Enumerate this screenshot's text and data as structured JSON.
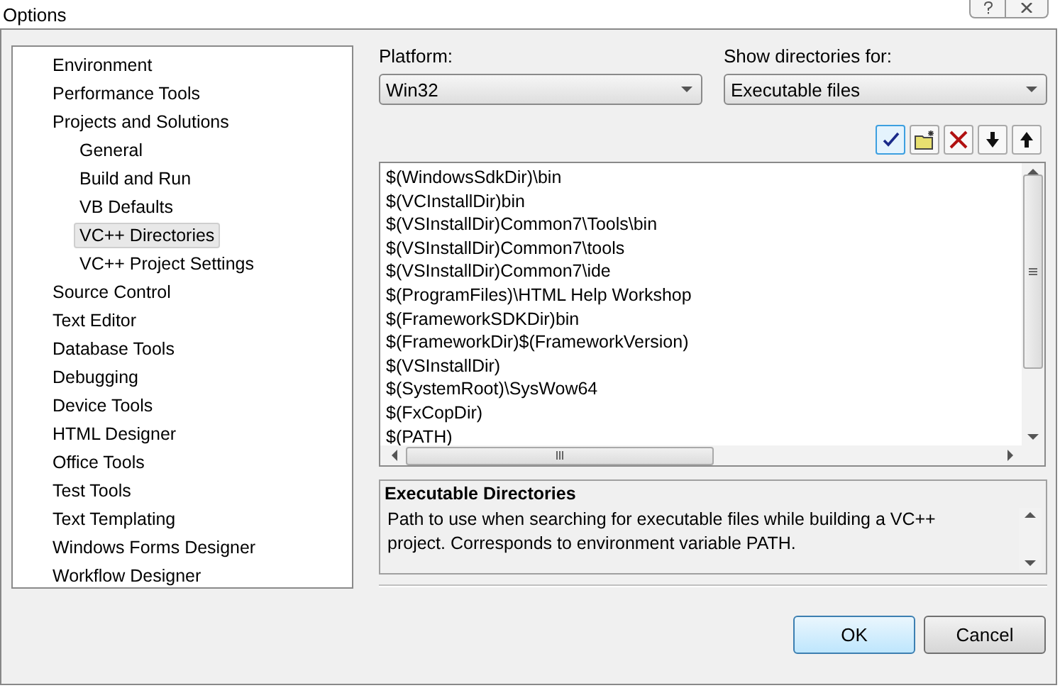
{
  "window": {
    "title": "Options"
  },
  "tree": [
    {
      "label": "Environment",
      "selected": false
    },
    {
      "label": "Performance Tools",
      "selected": false
    },
    {
      "label": "Projects and Solutions",
      "selected": false,
      "children": [
        {
          "label": "General",
          "selected": false
        },
        {
          "label": "Build and Run",
          "selected": false
        },
        {
          "label": "VB Defaults",
          "selected": false
        },
        {
          "label": "VC++ Directories",
          "selected": true
        },
        {
          "label": "VC++ Project Settings",
          "selected": false
        }
      ]
    },
    {
      "label": "Source Control",
      "selected": false
    },
    {
      "label": "Text Editor",
      "selected": false
    },
    {
      "label": "Database Tools",
      "selected": false
    },
    {
      "label": "Debugging",
      "selected": false
    },
    {
      "label": "Device Tools",
      "selected": false
    },
    {
      "label": "HTML Designer",
      "selected": false
    },
    {
      "label": "Office Tools",
      "selected": false
    },
    {
      "label": "Test Tools",
      "selected": false
    },
    {
      "label": "Text Templating",
      "selected": false
    },
    {
      "label": "Windows Forms Designer",
      "selected": false
    },
    {
      "label": "Workflow Designer",
      "selected": false
    }
  ],
  "platform": {
    "label": "Platform:",
    "value": "Win32"
  },
  "show_directories": {
    "label": "Show directories for:",
    "value": "Executable files"
  },
  "toolbar": [
    {
      "kind": "check",
      "selected": true
    },
    {
      "kind": "new-folder",
      "selected": false
    },
    {
      "kind": "delete",
      "selected": false
    },
    {
      "kind": "down",
      "selected": false
    },
    {
      "kind": "up",
      "selected": false
    }
  ],
  "directories": [
    "$(WindowsSdkDir)\\bin",
    "$(VCInstallDir)bin",
    "$(VSInstallDir)Common7\\Tools\\bin",
    "$(VSInstallDir)Common7\\tools",
    "$(VSInstallDir)Common7\\ide",
    "$(ProgramFiles)\\HTML Help Workshop",
    "$(FrameworkSDKDir)bin",
    "$(FrameworkDir)$(FrameworkVersion)",
    "$(VSInstallDir)",
    "$(SystemRoot)\\SysWow64",
    "$(FxCopDir)",
    "$(PATH)"
  ],
  "description": {
    "title": "Executable Directories",
    "text": "Path to use when searching for executable files while building a VC++ project.  Corresponds to environment variable PATH."
  },
  "buttons": [
    {
      "label": "OK",
      "default": true
    },
    {
      "label": "Cancel",
      "default": false
    }
  ]
}
